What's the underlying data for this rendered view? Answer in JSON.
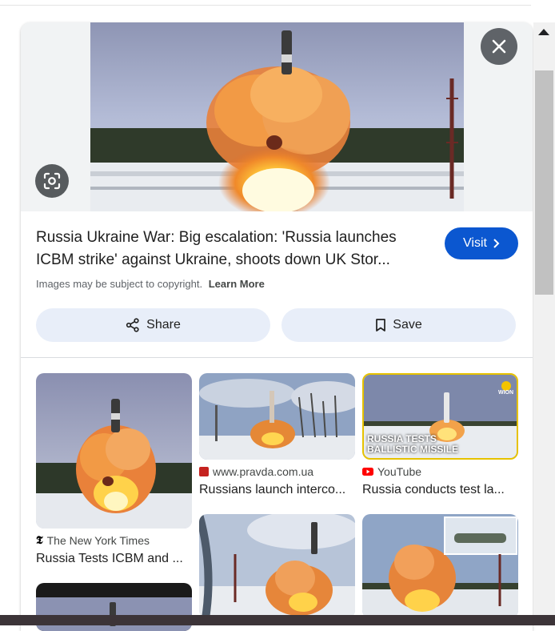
{
  "result": {
    "title": "Russia Ukraine War: Big escalation: 'Russia launches ICBM strike' against Ukraine, shoots down UK Stor...",
    "visit_label": "Visit",
    "copyright_text": "Images may be subject to copyright.",
    "learn_more": "Learn More",
    "share_label": "Share",
    "save_label": "Save"
  },
  "icons": {
    "close": "close-icon",
    "lens": "lens-icon",
    "share": "share-icon",
    "save": "bookmark-icon",
    "visit": "chevron-right-icon"
  },
  "related": [
    {
      "source": "The New York Times",
      "caption": "Russia Tests ICBM and ..."
    },
    {
      "source": "www.pravda.com.ua",
      "caption": "Russians launch interco..."
    },
    {
      "source": "YouTube",
      "caption": "Russia conducts test la..."
    }
  ],
  "thumb_overlay": {
    "line1": "RUSSIA TESTS",
    "line2": "BALLISTIC MISSILE",
    "brand": "WION"
  },
  "colors": {
    "accent": "#0b57d0",
    "action_bg": "#e8eef9",
    "close_bg": "#5f6368",
    "youtube": "#ff0000",
    "pravda": "#c5221f"
  }
}
